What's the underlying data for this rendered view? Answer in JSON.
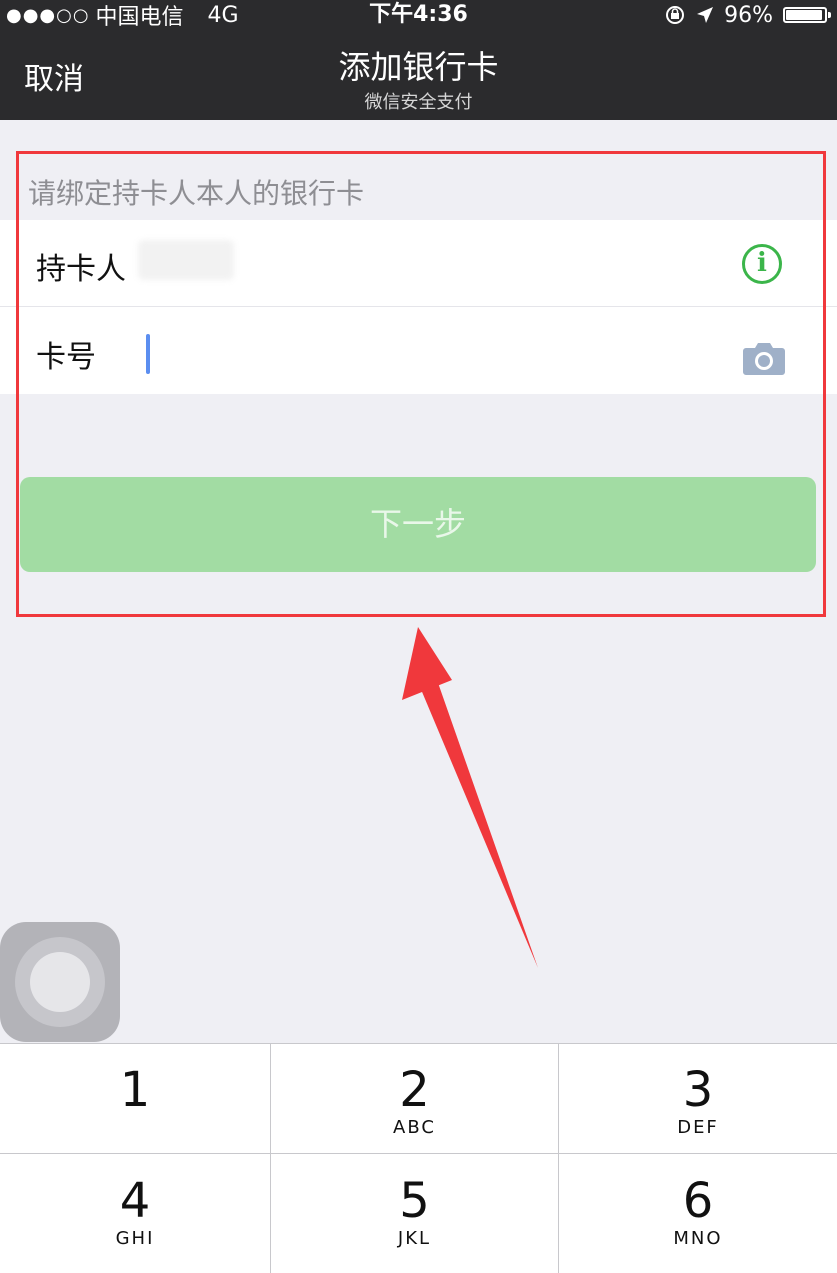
{
  "status_bar": {
    "signal": "●●●○○",
    "carrier": "中国电信",
    "network": "4G",
    "time": "下午4:36",
    "battery_percent_text": "96%",
    "battery_level": 0.96,
    "icons": [
      "lock-rotation-icon",
      "location-arrow-icon",
      "battery-icon"
    ]
  },
  "nav": {
    "cancel_label": "取消",
    "title": "添加银行卡",
    "subtitle": "微信安全支付"
  },
  "form": {
    "hint": "请绑定持卡人本人的银行卡",
    "cardholder_label": "持卡人",
    "card_number_label": "卡号",
    "card_number_value": "",
    "info_icon_glyph": "i",
    "icons": [
      "info-icon",
      "camera-icon"
    ]
  },
  "next_button": {
    "label": "下一步",
    "color": "#a2dca3"
  },
  "keypad": {
    "keys": [
      {
        "digit": "1",
        "letters": ""
      },
      {
        "digit": "2",
        "letters": "ABC"
      },
      {
        "digit": "3",
        "letters": "DEF"
      },
      {
        "digit": "4",
        "letters": "GHI"
      },
      {
        "digit": "5",
        "letters": "JKL"
      },
      {
        "digit": "6",
        "letters": "MNO"
      }
    ]
  },
  "colors": {
    "nav_background": "#2b2b2d",
    "page_background": "#efeff4",
    "annotation_red": "#f0383c",
    "info_green": "#3bb54a"
  }
}
